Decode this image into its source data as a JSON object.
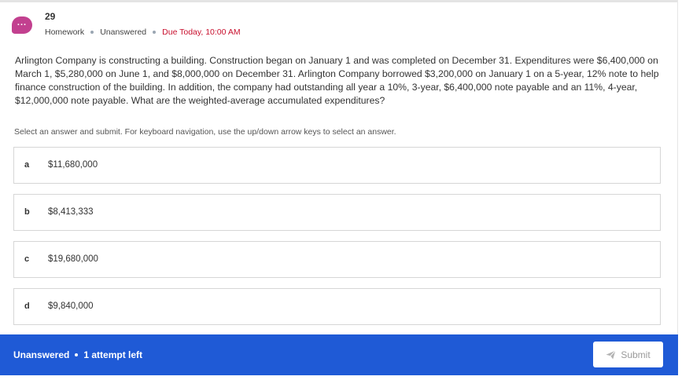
{
  "question": {
    "icon": "chat-bubble-icon",
    "icon_glyph": "...",
    "number": "29",
    "meta": {
      "type": "Homework",
      "status": "Unanswered",
      "due": "Due Today, 10:00 AM"
    },
    "text": "Arlington Company is constructing a building. Construction began on January 1 and was completed on December 31. Expenditures were $6,400,000 on March 1, $5,280,000 on June 1, and $8,000,000 on December 31. Arlington Company borrowed $3,200,000 on January 1 on a 5-year, 12% note to help finance construction of the building. In addition, the company had outstanding all year a 10%, 3-year, $6,400,000 note payable and an 11%, 4-year, $12,000,000 note payable. What are the weighted-average accumulated expenditures?",
    "instructions": "Select an answer and submit. For keyboard navigation, use the up/down arrow keys to select an answer."
  },
  "options": [
    {
      "letter": "a",
      "text": "$11,680,000"
    },
    {
      "letter": "b",
      "text": "$8,413,333"
    },
    {
      "letter": "c",
      "text": "$19,680,000"
    },
    {
      "letter": "d",
      "text": "$9,840,000"
    }
  ],
  "footer": {
    "status": "Unanswered",
    "attempts": "1 attempt left",
    "submit_label": "Submit",
    "submit_icon": "send-icon"
  },
  "colors": {
    "accent": "#1f5ad6",
    "icon": "#c2408f",
    "due": "#c8102e"
  }
}
